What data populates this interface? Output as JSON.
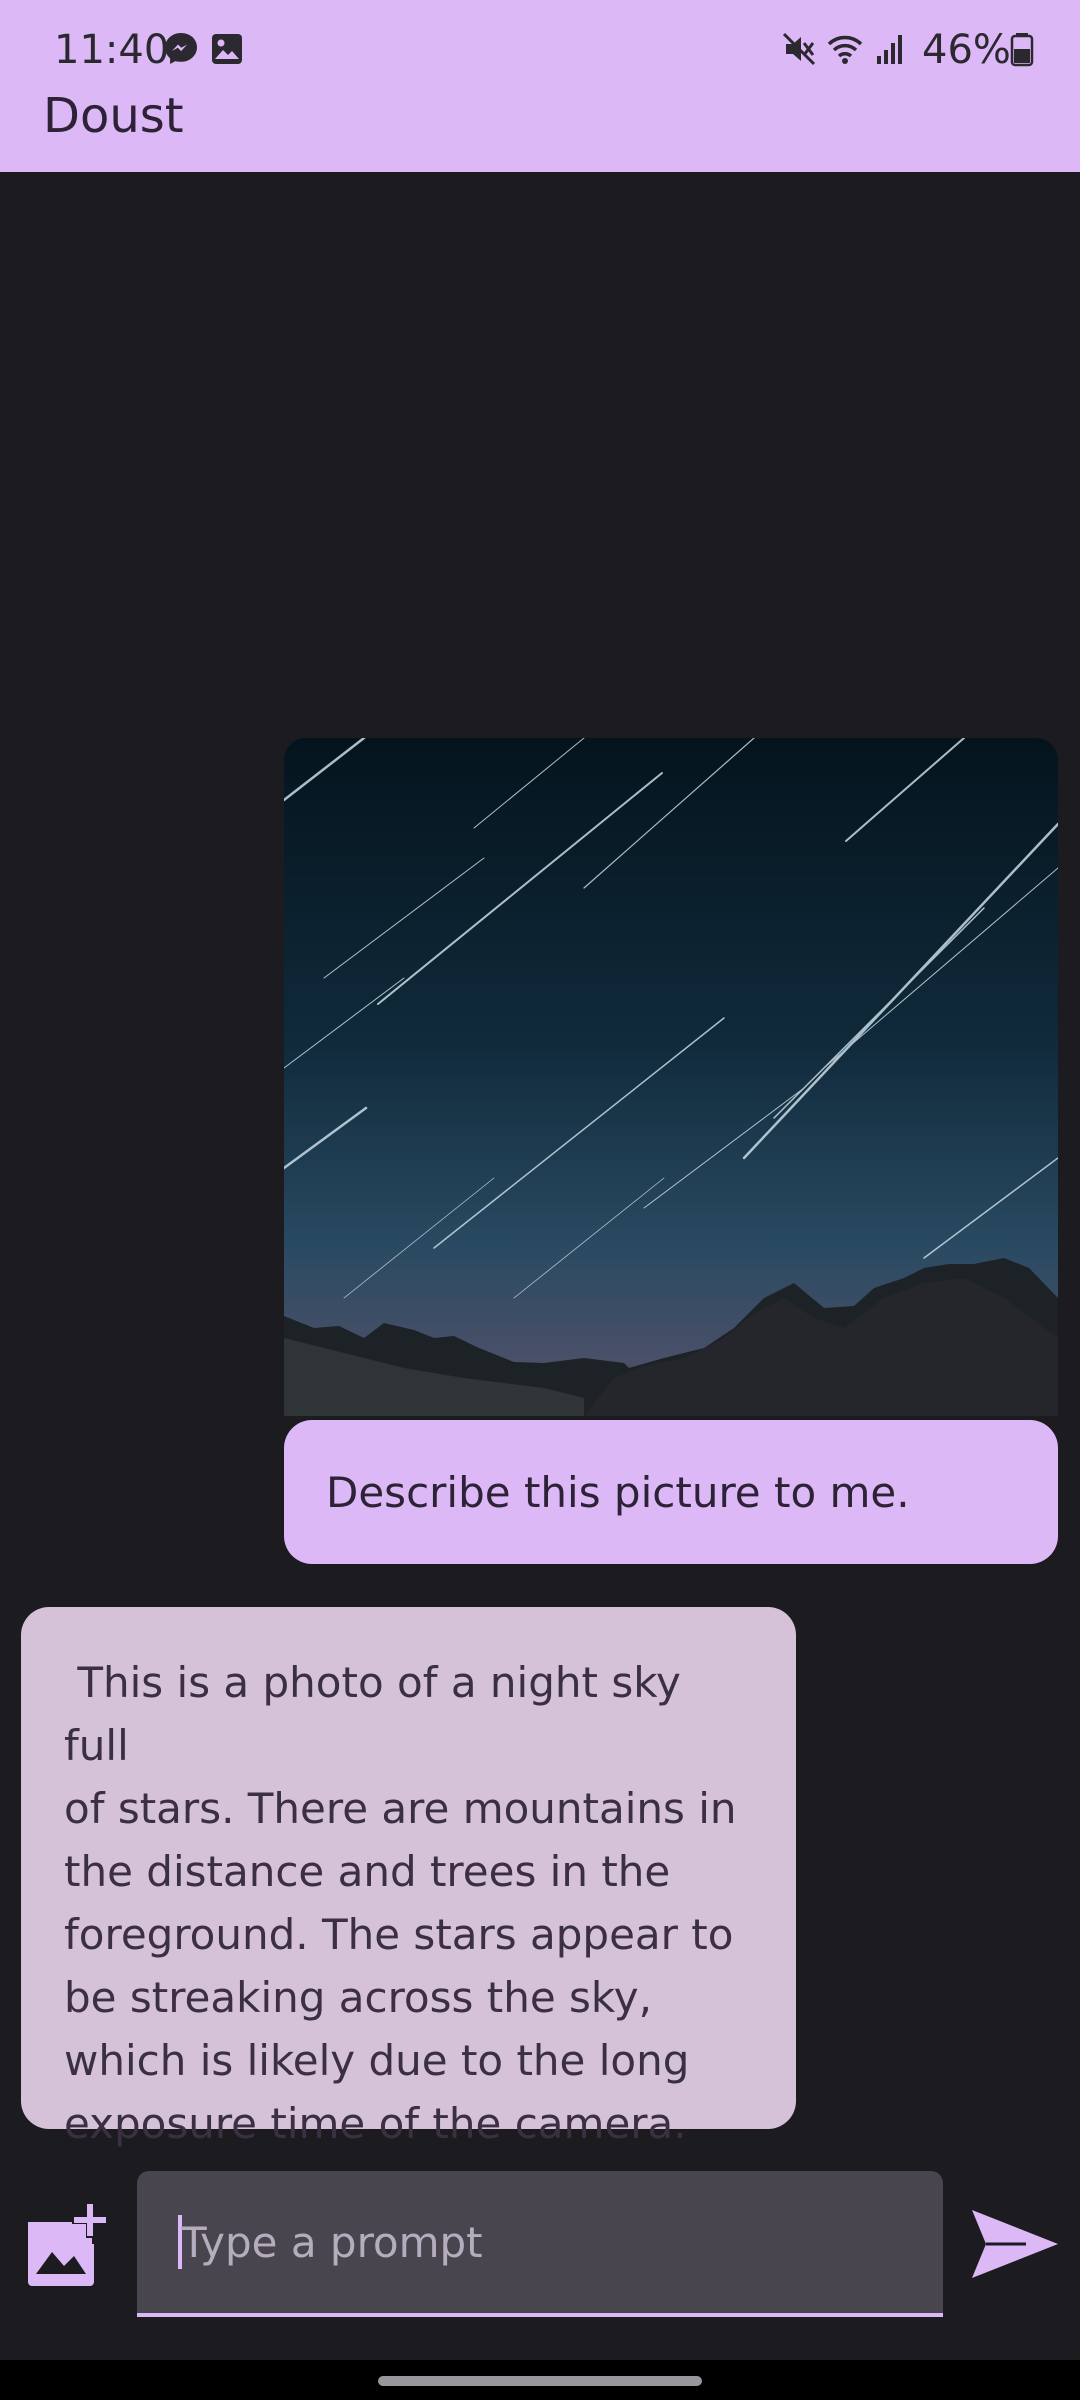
{
  "status_bar": {
    "time": "11:40",
    "battery_percent": "46%",
    "left_icons": [
      "messenger-icon",
      "gallery-icon"
    ],
    "right_icons": [
      "mute-icon",
      "wifi-icon",
      "signal-icon",
      "battery-icon"
    ]
  },
  "app": {
    "title": "Doust"
  },
  "chat": {
    "image": {
      "icon": "night-sky-photo"
    },
    "user_message": "Describe this picture to me.",
    "model_message": " This is a photo of a night sky full\nof stars. There are mountains in\nthe distance and trees in the\nforeground. The stars appear to\nbe streaking across the sky,\nwhich is likely due to the long\nexposure time of the camera."
  },
  "input": {
    "placeholder": "Type a prompt",
    "add_image_icon": "add-photo-icon",
    "send_icon": "send-icon"
  },
  "colors": {
    "accent": "#dcb9f6",
    "background": "#1c1b1f",
    "model_bubble": "#d5c2d9",
    "field": "#49454f"
  }
}
